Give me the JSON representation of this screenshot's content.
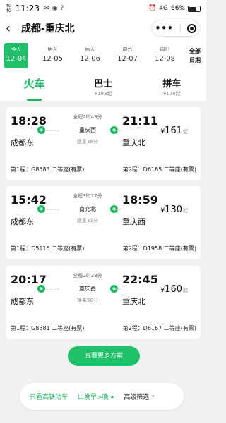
{
  "status_bar": {
    "signal1": "4G",
    "signal2": "4G",
    "time": "11:23",
    "network": "4G",
    "battery": "66%",
    "icons": [
      "message-icon",
      "location-icon",
      "question-icon",
      "alarm-icon",
      "battery-icon"
    ]
  },
  "header": {
    "title": "成都-重庆北"
  },
  "dates": [
    {
      "day": "今天",
      "date": "12-04",
      "active": true
    },
    {
      "day": "明天",
      "date": "12-05"
    },
    {
      "day": "后天",
      "date": "12-06"
    },
    {
      "day": "周六",
      "date": "12-07"
    },
    {
      "day": "周日",
      "date": "12-08"
    }
  ],
  "all_dates": {
    "line1": "全部",
    "line2": "日期"
  },
  "modes": [
    {
      "label": "火车",
      "price": ""
    },
    {
      "label": "巴士",
      "price": "¥193起"
    },
    {
      "label": "拼车",
      "price": "¥178起"
    }
  ],
  "trips": [
    {
      "dep_time": "18:28",
      "arr_time": "21:11",
      "dep_station": "成都东",
      "arr_station": "重庆北",
      "duration": "全程2时43分",
      "via": "重庆西",
      "transfer": "换乘38分",
      "price": "161",
      "leg1": "第1程：G8583 二等座(有票)",
      "leg2": "第2程：D6165 二等座(有票)"
    },
    {
      "dep_time": "15:42",
      "arr_time": "18:59",
      "dep_station": "成都东",
      "arr_station": "重庆西",
      "duration": "全程3时17分",
      "via": "南充北",
      "transfer": "换乘31分",
      "price": "130",
      "leg1": "第1程：D5116 二等座(有票)",
      "leg2": "第2程：D1958 二等座(有票)"
    },
    {
      "dep_time": "20:17",
      "arr_time": "22:45",
      "dep_station": "成都东",
      "arr_station": "重庆北",
      "duration": "全程2时28分",
      "via": "重庆西",
      "transfer": "换乘50分",
      "price": "160",
      "leg1": "第1程：G8581 二等座(有票)",
      "leg2": "第2程：D6167 二等座(有票)"
    }
  ],
  "price_currency": "¥",
  "price_suffix": "起",
  "more_button": "查看更多方案",
  "filters": {
    "only_high_speed": "只看高铁动车",
    "sort": "出发早>晚",
    "advanced": "高级筛选"
  },
  "colors": {
    "accent": "#19b45e",
    "background": "#f0f1f3"
  }
}
